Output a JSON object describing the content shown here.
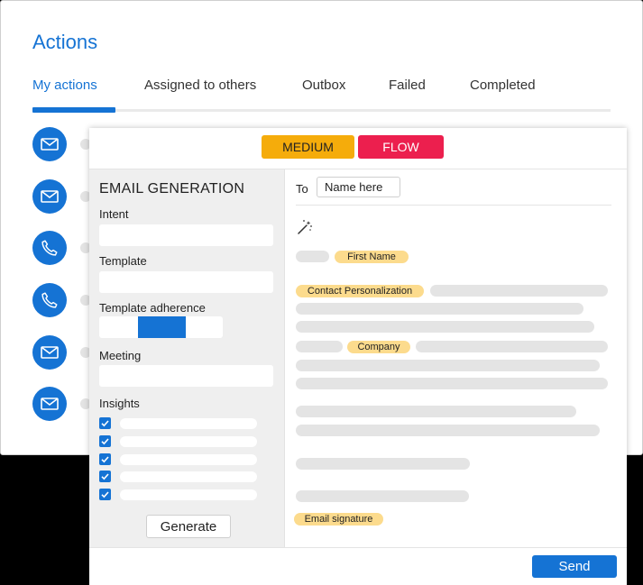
{
  "page": {
    "title": "Actions"
  },
  "tabs": [
    {
      "label": "My actions",
      "active": true
    },
    {
      "label": "Assigned to others"
    },
    {
      "label": "Outbox"
    },
    {
      "label": "Failed"
    },
    {
      "label": "Completed"
    }
  ],
  "actions": [
    {
      "icon": "envelope-icon"
    },
    {
      "icon": "envelope-icon"
    },
    {
      "icon": "phone-icon"
    },
    {
      "icon": "phone-icon"
    },
    {
      "icon": "envelope-icon"
    },
    {
      "icon": "envelope-icon"
    }
  ],
  "badges": {
    "medium": "MEDIUM",
    "flow": "FLOW"
  },
  "email_generation": {
    "heading": "EMAIL GENERATION",
    "intent_label": "Intent",
    "template_label": "Template",
    "adherence_label": "Template adherence",
    "meeting_label": "Meeting",
    "insights_label": "Insights",
    "generate_label": "Generate"
  },
  "email": {
    "to_label": "To",
    "to_value": "Name here",
    "tags": {
      "first_name": "First Name",
      "contact_personalization": "Contact Personalization",
      "company": "Company",
      "email_signature": "Email signature"
    }
  },
  "footer": {
    "send_label": "Send"
  },
  "colors": {
    "accent": "#1573d4",
    "medium": "#f5ac0b",
    "flow": "#ec1f4e",
    "tag": "#fcdb8d"
  }
}
